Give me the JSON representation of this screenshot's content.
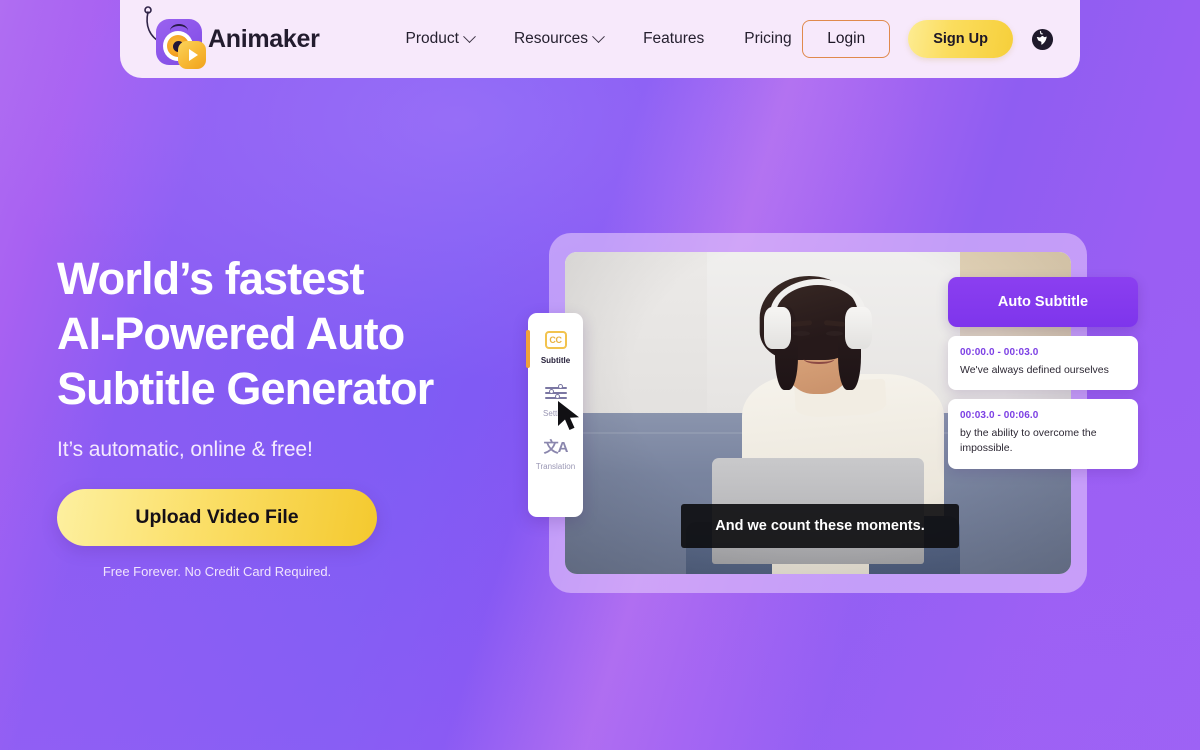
{
  "brand": {
    "name": "Animaker",
    "logo_icon": "animaker-eye-play-logo"
  },
  "nav": {
    "items": [
      {
        "label": "Product",
        "has_dropdown": true
      },
      {
        "label": "Resources",
        "has_dropdown": true
      },
      {
        "label": "Features",
        "has_dropdown": false
      },
      {
        "label": "Pricing",
        "has_dropdown": false
      }
    ]
  },
  "actions": {
    "login_label": "Login",
    "signup_label": "Sign Up",
    "language_icon": "globe-icon"
  },
  "hero": {
    "heading_line1": "World’s fastest",
    "heading_line2": "AI-Powered Auto",
    "heading_line3": "Subtitle Generator",
    "subheading": "It’s automatic, online & free!",
    "cta_label": "Upload Video File",
    "cta_note": "Free Forever. No Credit Card Required."
  },
  "mockup": {
    "caption_text": "And we count these moments.",
    "toolbar": {
      "items": [
        {
          "label": "Subtitle",
          "icon": "cc-icon",
          "active": true
        },
        {
          "label": "Setting",
          "icon": "sliders-icon",
          "active": false
        },
        {
          "label": "Translation",
          "icon": "translate-icon",
          "active": false
        }
      ],
      "cc_glyph": "CC",
      "translate_glyph": "文A"
    },
    "cursor_icon": "mouse-cursor-arrow",
    "subtitle_panel": {
      "title": "Auto Subtitle",
      "entries": [
        {
          "time": "00:00.0 - 00:03.0",
          "text": "We've always defined ourselves"
        },
        {
          "time": "00:03.0 - 00:06.0",
          "text": "by the ability to overcome the impossible."
        }
      ]
    }
  },
  "colors": {
    "background_purple": "#8f5cf0",
    "header_lavender": "#f7e9fb",
    "accent_yellow": "#f6cf3a",
    "accent_orange": "#e08a4d",
    "subtitle_purple": "#7c3fe4"
  }
}
